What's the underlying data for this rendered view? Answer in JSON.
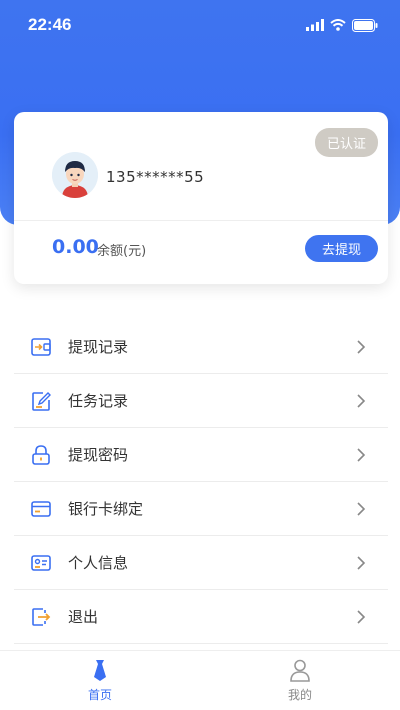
{
  "status_bar": {
    "time": "22:46"
  },
  "profile": {
    "verified_badge": "已认证",
    "phone": "135******55",
    "balance": "0.00",
    "balance_label": "余额(元)",
    "withdraw_button": "去提现"
  },
  "menu": {
    "items": [
      {
        "label": "提现记录",
        "icon": "wallet-arrow-icon"
      },
      {
        "label": "任务记录",
        "icon": "edit-note-icon"
      },
      {
        "label": "提现密码",
        "icon": "lock-icon"
      },
      {
        "label": "银行卡绑定",
        "icon": "bank-card-icon"
      },
      {
        "label": "个人信息",
        "icon": "id-card-icon"
      },
      {
        "label": "退出",
        "icon": "logout-icon"
      }
    ]
  },
  "tabbar": {
    "tabs": [
      {
        "label": "首页",
        "icon": "home-tie-icon",
        "active": true
      },
      {
        "label": "我的",
        "icon": "user-icon",
        "active": false
      }
    ]
  },
  "colors": {
    "accent": "#3a6ff2",
    "badge": "#cfcbc4"
  }
}
